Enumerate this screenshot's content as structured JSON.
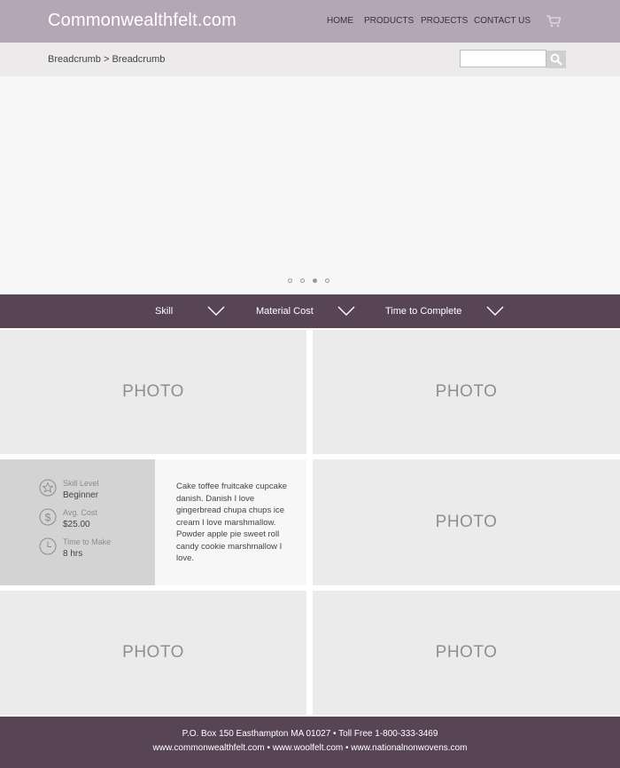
{
  "header": {
    "logo": "Commonwealthfelt.com",
    "nav": [
      "HOME",
      "PRODUCTS",
      "PROJECTS",
      "CONTACT US"
    ]
  },
  "breadcrumb": "Breadcrumb > Breadcrumb",
  "search": {
    "placeholder": "",
    "value": ""
  },
  "carousel": {
    "slide_count": 4,
    "active_index": 2
  },
  "filters": [
    "Skill",
    "Material Cost",
    "Time to Complete"
  ],
  "tiles": {
    "photo_label": "PHOTO"
  },
  "project": {
    "skill_label": "Skill Level",
    "skill_value": "Beginner",
    "cost_label": "Avg. Cost",
    "cost_value": "$25.00",
    "time_label": "Time to Make",
    "time_value": "8 hrs",
    "description": "Cake toffee fruitcake cupcake danish. Danish I love gingerbread chupa chups ice cream I love marshmallow. Powder apple pie sweet roll candy cookie marshmallow I love."
  },
  "footer": {
    "line1": "P.O. Box 150 Easthampton MA 01027 • Toll Free 1-800-333-3469",
    "line2": "www.commonwealthfelt.com • www.woolfelt.com • www.nationalnonwovens.com"
  },
  "colors": {
    "header_bg": "#b5a6b6",
    "accent_dark": "#574556",
    "tile_bg": "#ecebec"
  }
}
